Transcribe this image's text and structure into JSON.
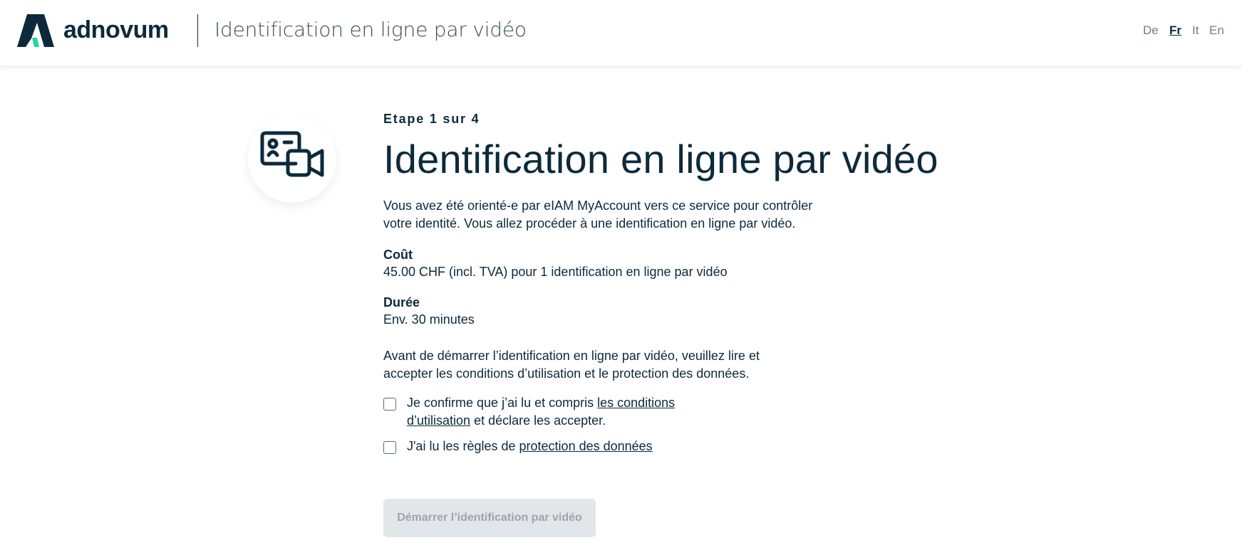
{
  "header": {
    "brand": "adnovum",
    "title": "Identification en ligne par vidéo",
    "languages": [
      {
        "label": "De",
        "active": false
      },
      {
        "label": "Fr",
        "active": true
      },
      {
        "label": "It",
        "active": false
      },
      {
        "label": "En",
        "active": false
      }
    ]
  },
  "main": {
    "icon": "video-id-card-icon",
    "step": "Etape 1 sur 4",
    "title": "Identification en ligne par vidéo",
    "intro": "Vous avez été orienté-e par eIAM MyAccount vers ce service pour contrôler votre identité. Vous allez procéder à une identification en ligne par vidéo.",
    "cost_label": "Coût",
    "cost_value": "45.00 CHF (incl. TVA) pour 1 identification en ligne par vidéo",
    "duration_label": "Durée",
    "duration_value": "Env. 30 minutes",
    "notice": "Avant de démarrer l’identification en ligne par vidéo, veuillez lire et accepter les conditions d’utilisation et le protection des données.",
    "terms_checkbox": {
      "checked": false,
      "text_before": "Je confirme que j’ai lu et compris ",
      "link": "les conditions d’utilisation",
      "text_after": " et déclare les accepter."
    },
    "privacy_checkbox": {
      "checked": false,
      "text_before": "J'ai lu les règles de ",
      "link": "protection des données"
    },
    "start_button": {
      "label": "Démarrer l’identification par vidéo",
      "enabled": false
    }
  },
  "colors": {
    "primary": "#0c2a3b",
    "accent": "#1fd8a4",
    "disabled_bg": "#e2e6e9",
    "disabled_text": "#9aa6ae"
  }
}
